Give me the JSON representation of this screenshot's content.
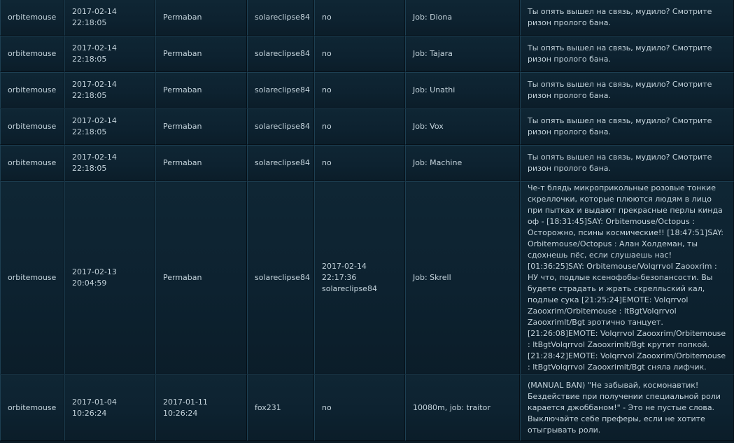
{
  "rows": [
    {
      "ckey": "orbitemouse",
      "date": "2017-02-14 22:18:05",
      "duration": "Permaban",
      "admin": "solareclipse84",
      "unbanned": "no",
      "job": "Job: Diona",
      "reason": "Ты опять вышел на связь, мудило? Смотрите ризон пролого бана."
    },
    {
      "ckey": "orbitemouse",
      "date": "2017-02-14 22:18:05",
      "duration": "Permaban",
      "admin": "solareclipse84",
      "unbanned": "no",
      "job": "Job: Tajara",
      "reason": "Ты опять вышел на связь, мудило? Смотрите ризон пролого бана."
    },
    {
      "ckey": "orbitemouse",
      "date": "2017-02-14 22:18:05",
      "duration": "Permaban",
      "admin": "solareclipse84",
      "unbanned": "no",
      "job": "Job: Unathi",
      "reason": "Ты опять вышел на связь, мудило? Смотрите ризон пролого бана."
    },
    {
      "ckey": "orbitemouse",
      "date": "2017-02-14 22:18:05",
      "duration": "Permaban",
      "admin": "solareclipse84",
      "unbanned": "no",
      "job": "Job: Vox",
      "reason": "Ты опять вышел на связь, мудило? Смотрите ризон пролого бана."
    },
    {
      "ckey": "orbitemouse",
      "date": "2017-02-14 22:18:05",
      "duration": "Permaban",
      "admin": "solareclipse84",
      "unbanned": "no",
      "job": "Job: Machine",
      "reason": "Ты опять вышел на связь, мудило? Смотрите ризон пролого бана."
    },
    {
      "ckey": "orbitemouse",
      "date": "2017-02-13 20:04:59",
      "duration": "Permaban",
      "admin": "solareclipse84",
      "unbanned": "2017-02-14 22:17:36 solareclipse84",
      "job": "Job: Skrell",
      "reason": "Че-т блядь микроприкольные розовые тонкие скреллочки, которые плюются людям в лицо при пытках и выдают прекрасные перлы кинда оф - [18:31:45]SAY: Orbitemouse/Octopus : Осторожно, псины космические!! [18:47:51]SAY: Orbitemouse/Octopus : Алан Холдеман, ты сдохнешь пёс, если слушаешь нас! [01:36:25]SAY: Orbitemouse/Volqrrvol Zaooxrim : НУ что, подлые ксенофобы-безопансости. Вы будете страдать и жрать скрелльский кал, подлые сука [21:25:24]EMOTE: Volqrrvol Zaooxrim/Orbitemouse : ltBgtVolqrrvol Zaooxrimlt/Bgt эротично танцует. [21:26:08]EMOTE: Volqrrvol Zaooxrim/Orbitemouse : ltBgtVolqrrvol Zaooxrimlt/Bgt крутит попкой. [21:28:42]EMOTE: Volqrrvol Zaooxrim/Orbitemouse : ltBgtVolqrrvol Zaooxrimlt/Bgt сняла лифчик."
    },
    {
      "ckey": "orbitemouse",
      "date": "2017-01-04 10:26:24",
      "duration": "2017-01-11 10:26:24",
      "admin": "fox231",
      "unbanned": "no",
      "job": "10080m, job: traitor",
      "reason": "(MANUAL BAN) \"Не забывай, космонавтик! Бездействие при получении специальной роли карается джоббаном!\" - Это не пустые слова. Выключайте себе преферы, если не хотите отыгрывать роли."
    }
  ]
}
